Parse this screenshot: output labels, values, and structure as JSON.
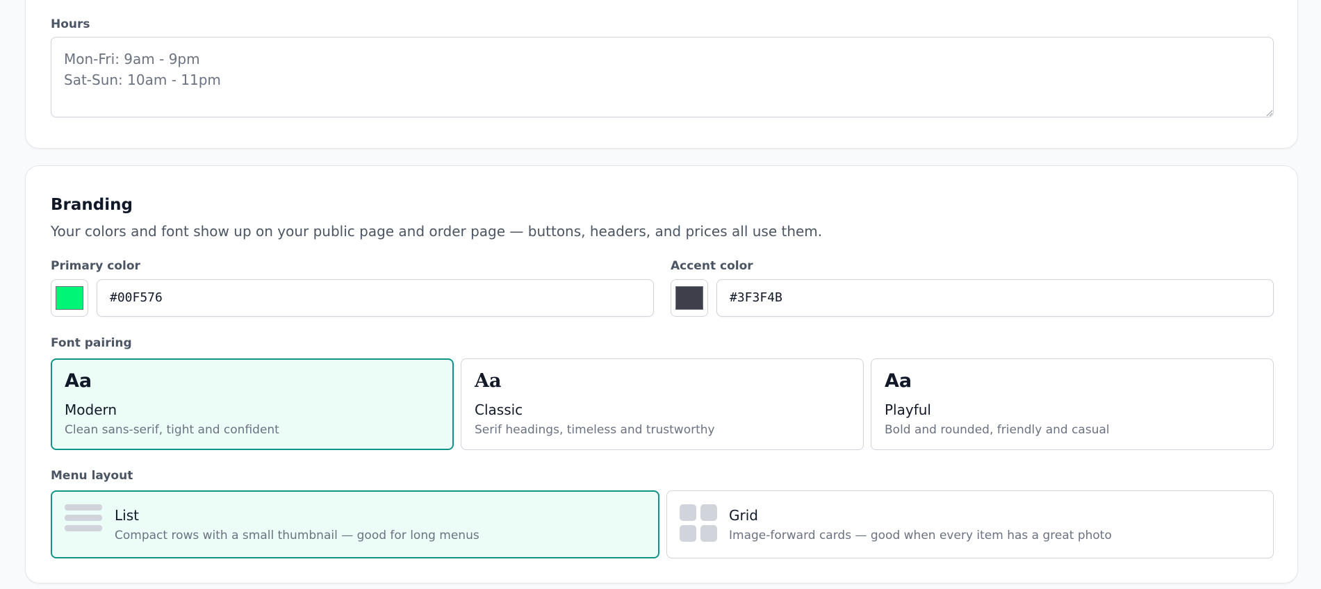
{
  "hours": {
    "label": "Hours",
    "placeholder": "Mon-Fri: 9am - 9pm\nSat-Sun: 10am - 11pm"
  },
  "branding": {
    "title": "Branding",
    "description": "Your colors and font show up on your public page and order page — buttons, headers, and prices all use them.",
    "primary": {
      "label": "Primary color",
      "value": "#00F576",
      "swatch_color": "#00F576"
    },
    "accent": {
      "label": "Accent color",
      "value": "#3F3F4B",
      "swatch_color": "#3F3F4B"
    },
    "font_pairing": {
      "label": "Font pairing",
      "selected": "Modern",
      "options": [
        {
          "sample": "Aa",
          "name": "Modern",
          "description": "Clean sans-serif, tight and confident"
        },
        {
          "sample": "Aa",
          "name": "Classic",
          "description": "Serif headings, timeless and trustworthy"
        },
        {
          "sample": "Aa",
          "name": "Playful",
          "description": "Bold and rounded, friendly and casual"
        }
      ]
    },
    "menu_layout": {
      "label": "Menu layout",
      "selected": "List",
      "options": [
        {
          "icon": "list-layout-icon",
          "name": "List",
          "description": "Compact rows with a small thumbnail — good for long menus"
        },
        {
          "icon": "grid-layout-icon",
          "name": "Grid",
          "description": "Image-forward cards — good when every item has a great photo"
        }
      ]
    }
  },
  "colors": {
    "selected_border": "#0F9488",
    "selected_background": "#ECFDF8",
    "icon_gray": "#D1D5DB"
  }
}
